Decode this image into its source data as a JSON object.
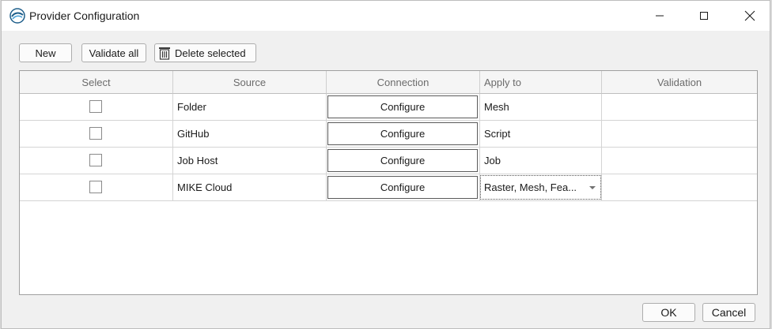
{
  "window": {
    "title": "Provider Configuration",
    "app_icon": "provider-app-icon",
    "controls": [
      "minimize-icon",
      "maximize-icon",
      "close-icon"
    ]
  },
  "toolbar": {
    "new_label": "New",
    "validate_all_label": "Validate all",
    "delete_selected_label": "Delete selected",
    "delete_icon": "trash-icon"
  },
  "grid": {
    "columns": [
      "Select",
      "Source",
      "Connection",
      "Apply to",
      "Validation"
    ],
    "rows": [
      {
        "selected": false,
        "source": "Folder",
        "connection": "Configure",
        "apply_to": "Mesh",
        "validation": ""
      },
      {
        "selected": false,
        "source": "GitHub",
        "connection": "Configure",
        "apply_to": "Script",
        "validation": ""
      },
      {
        "selected": false,
        "source": "Job Host",
        "connection": "Configure",
        "apply_to": "Job",
        "validation": ""
      },
      {
        "selected": false,
        "source": "MIKE Cloud",
        "connection": "Configure",
        "apply_to": "Raster, Mesh, Fea...",
        "validation": ""
      }
    ]
  },
  "footer": {
    "ok_label": "OK",
    "cancel_label": "Cancel"
  }
}
